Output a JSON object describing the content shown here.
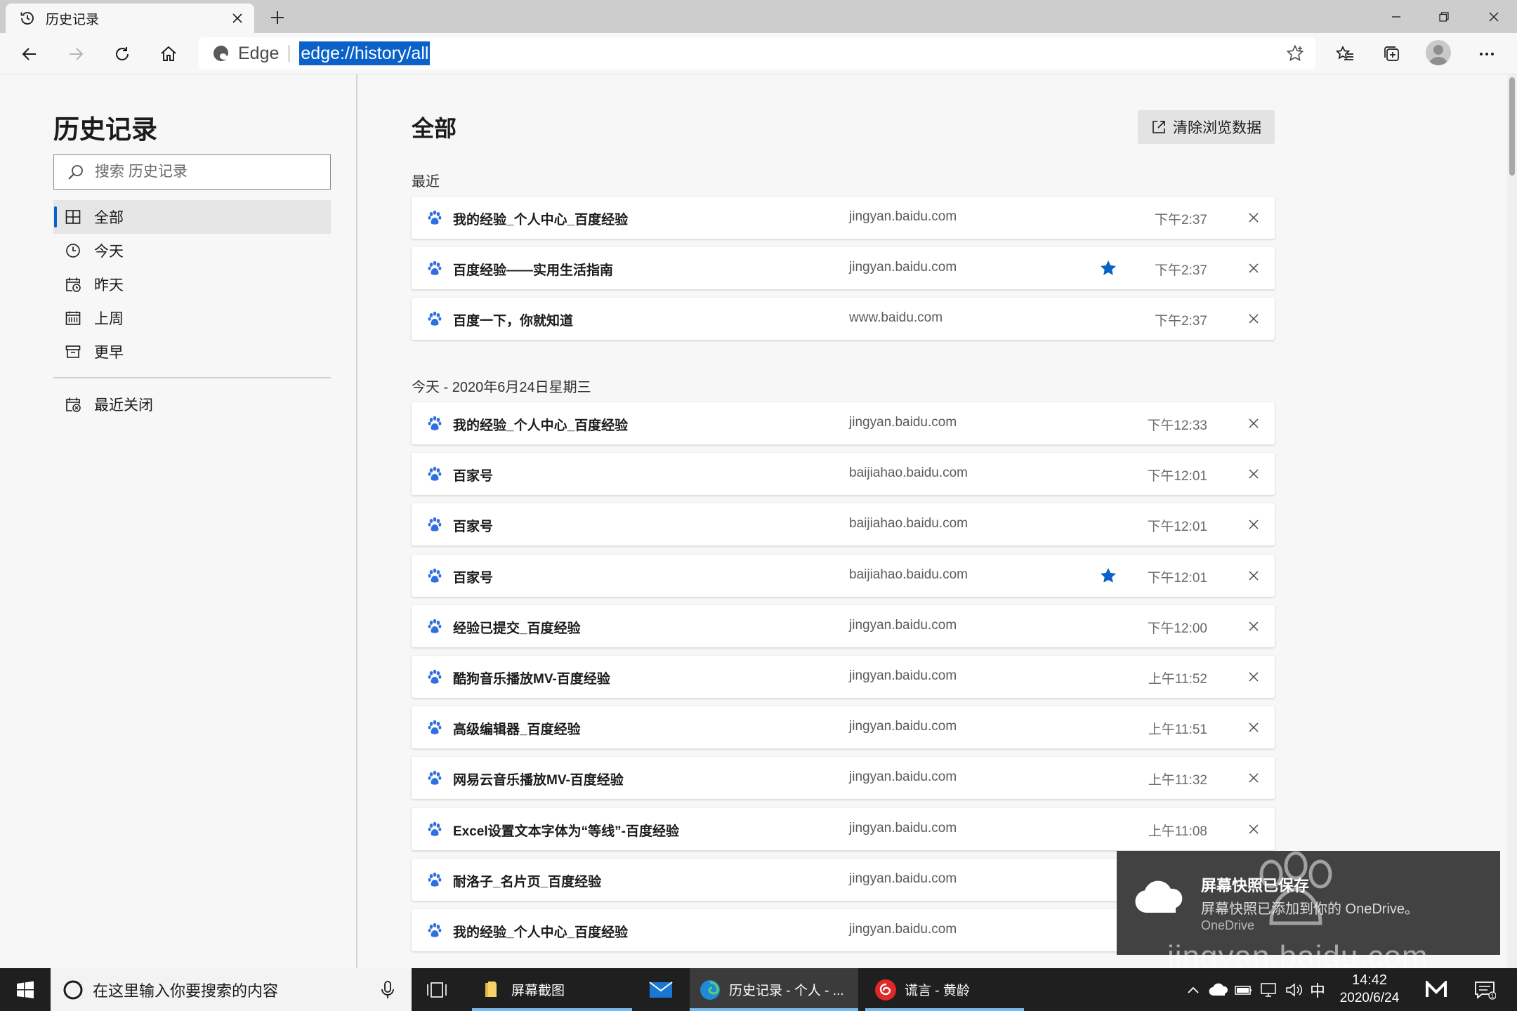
{
  "tab": {
    "title": "历史记录",
    "icon": "history-icon"
  },
  "toolbar": {
    "brand": "Edge",
    "url": "edge://history/all"
  },
  "sidebar": {
    "title": "历史记录",
    "search_placeholder": "搜索 历史记录",
    "nav": [
      {
        "label": "全部",
        "icon": "grid-icon",
        "active": true
      },
      {
        "label": "今天",
        "icon": "clock-icon"
      },
      {
        "label": "昨天",
        "icon": "calendar-back-icon"
      },
      {
        "label": "上周",
        "icon": "calendar-week-icon"
      },
      {
        "label": "更早",
        "icon": "archive-icon"
      }
    ],
    "recently_closed": "最近关闭"
  },
  "main": {
    "title": "全部",
    "clear_button": "清除浏览数据",
    "groups": [
      {
        "header": "最近",
        "rows": [
          {
            "title": "我的经验_个人中心_百度经验",
            "domain": "jingyan.baidu.com",
            "time": "下午2:37",
            "starred": false
          },
          {
            "title": "百度经验——实用生活指南",
            "domain": "jingyan.baidu.com",
            "time": "下午2:37",
            "starred": true
          },
          {
            "title": "百度一下，你就知道",
            "domain": "www.baidu.com",
            "time": "下午2:37",
            "starred": false
          }
        ]
      },
      {
        "header": "今天 - 2020年6月24日星期三",
        "rows": [
          {
            "title": "我的经验_个人中心_百度经验",
            "domain": "jingyan.baidu.com",
            "time": "下午12:33",
            "starred": false
          },
          {
            "title": "百家号",
            "domain": "baijiahao.baidu.com",
            "time": "下午12:01",
            "starred": false
          },
          {
            "title": "百家号",
            "domain": "baijiahao.baidu.com",
            "time": "下午12:01",
            "starred": false
          },
          {
            "title": "百家号",
            "domain": "baijiahao.baidu.com",
            "time": "下午12:01",
            "starred": true
          },
          {
            "title": "经验已提交_百度经验",
            "domain": "jingyan.baidu.com",
            "time": "下午12:00",
            "starred": false
          },
          {
            "title": "酷狗音乐播放MV-百度经验",
            "domain": "jingyan.baidu.com",
            "time": "上午11:52",
            "starred": false
          },
          {
            "title": "高级编辑器_百度经验",
            "domain": "jingyan.baidu.com",
            "time": "上午11:51",
            "starred": false
          },
          {
            "title": "网易云音乐播放MV-百度经验",
            "domain": "jingyan.baidu.com",
            "time": "上午11:32",
            "starred": false
          },
          {
            "title": "Excel设置文本字体为“等线”-百度经验",
            "domain": "jingyan.baidu.com",
            "time": "上午11:08",
            "starred": false
          },
          {
            "title": "耐洛子_名片页_百度经验",
            "domain": "jingyan.baidu.com",
            "time": "",
            "starred": false
          },
          {
            "title": "我的经验_个人中心_百度经验",
            "domain": "jingyan.baidu.com",
            "time": "",
            "starred": false
          }
        ]
      }
    ]
  },
  "toast": {
    "title": "屏幕快照已保存",
    "body": "屏幕快照已添加到你的 OneDrive。",
    "source": "OneDrive"
  },
  "watermark": {
    "text": "jingyan.baidu.com"
  },
  "taskbar": {
    "search_placeholder": "在这里输入你要搜索的内容",
    "apps": [
      {
        "label": "屏幕截图",
        "icon": "folder-icon"
      },
      {
        "label": "",
        "icon": "mail-icon"
      },
      {
        "label": "历史记录 - 个人 - ...",
        "icon": "edge-icon",
        "active": true
      },
      {
        "label": "谎言 - 黄龄",
        "icon": "netease-music-icon"
      }
    ],
    "ime": "中",
    "time": "14:42",
    "date": "2020/6/24",
    "notification_count": "1"
  },
  "colors": {
    "accent": "#0a62c9",
    "taskbar": "#1f1f1f",
    "baidu_blue": "#2f6fe0"
  }
}
